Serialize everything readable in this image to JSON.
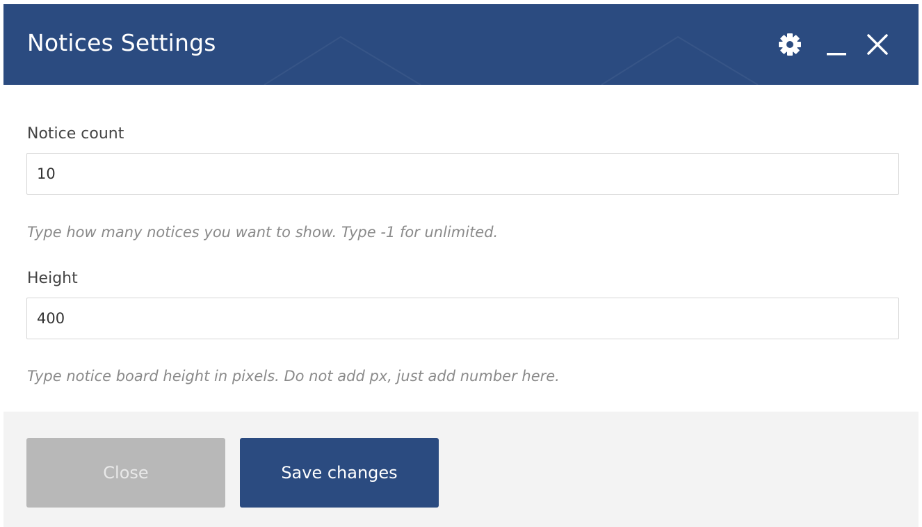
{
  "dialog": {
    "title": "Notices Settings",
    "header_icons": [
      "gear-icon",
      "minimize-icon",
      "close-icon"
    ],
    "colors": {
      "header_bg": "#2b4b80",
      "primary_button": "#2b4b80",
      "secondary_button": "#b8b8b8",
      "footer_bg": "#f3f3f3"
    }
  },
  "fields": {
    "notice_count": {
      "label": "Notice count",
      "value": "10",
      "help": "Type how many notices you want to show. Type -1 for unlimited."
    },
    "height": {
      "label": "Height",
      "value": "400",
      "help": "Type notice board height in pixels. Do not add px, just add number here."
    }
  },
  "footer": {
    "close_label": "Close",
    "save_label": "Save changes"
  }
}
